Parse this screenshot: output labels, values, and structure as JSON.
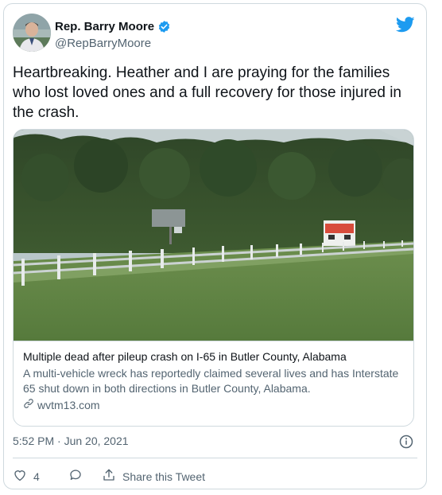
{
  "author": {
    "display_name": "Rep. Barry Moore",
    "handle": "@RepBarryMoore",
    "avatar_icon": "avatar-photo",
    "verified_icon": "verified-badge-icon"
  },
  "platform_icon": "twitter-bird-icon",
  "tweet": {
    "text": "Heartbreaking. Heather and I are praying for the families who lost loved ones and a full recovery for those injured in the crash."
  },
  "card": {
    "title": "Multiple dead after pileup crash on I-65 in Butler County, Alabama",
    "description": "A multi-vehicle wreck has reportedly claimed several lives and has Interstate 65 shut down in both directions in Butler County, Alabama.",
    "domain": "wvtm13.com",
    "link_icon": "link-icon"
  },
  "meta": {
    "timestamp": "5:52 PM · Jun 20, 2021"
  },
  "actions": {
    "like_count": "4",
    "share_label": "Share this Tweet"
  },
  "colors": {
    "accent": "#1d9bf0",
    "text": "#0f1419",
    "secondary": "#536471",
    "border": "#cfd9de"
  }
}
